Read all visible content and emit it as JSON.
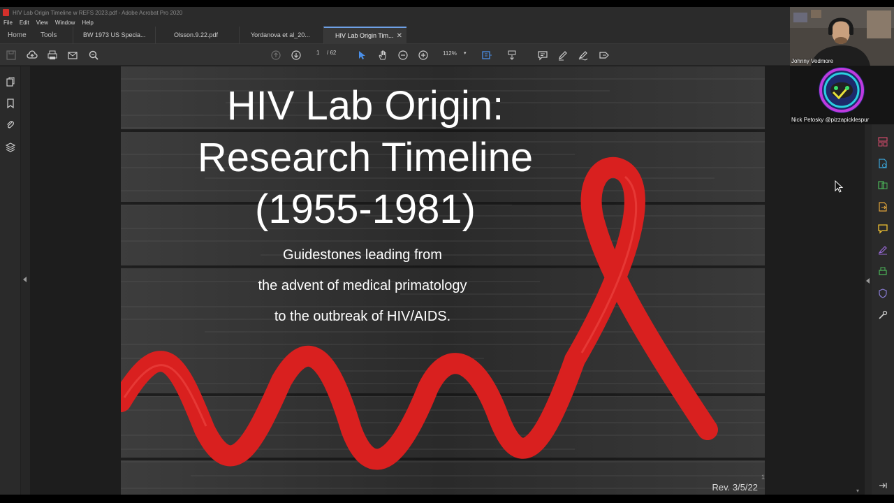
{
  "window": {
    "title": "HIV Lab Origin Timeline w REFS 2023.pdf - Adobe Acrobat Pro 2020"
  },
  "menu": [
    "File",
    "Edit",
    "View",
    "Window",
    "Help"
  ],
  "nav_tabs": {
    "home": "Home",
    "tools": "Tools"
  },
  "doc_tabs": [
    {
      "label": "BW 1973 US Specia..."
    },
    {
      "label": "Olsson.9.22.pdf"
    },
    {
      "label": "Yordanova et al_20..."
    },
    {
      "label": "HIV Lab Origin Tim..."
    }
  ],
  "toolbar": {
    "page_current": "1",
    "page_total": "/ 62",
    "zoom": "112%"
  },
  "slide": {
    "title_lines": [
      "HIV Lab Origin:",
      "Research Timeline",
      "(1955-1981)"
    ],
    "subtitle_lines": [
      "Guidestones leading from",
      "the advent of medical primatology",
      "to the outbreak of HIV/AIDS."
    ],
    "revision": "Rev. 3/5/22",
    "page_number": "1"
  },
  "webcams": {
    "cam1_name": "Johnny Vedmore",
    "cam2_name": "Nick Petosky @pizzapicklespur"
  },
  "colors": {
    "ribbon": "#d9201f",
    "active_tab_accent": "#6ea0e6",
    "acrobat_red": "#d3302b"
  }
}
